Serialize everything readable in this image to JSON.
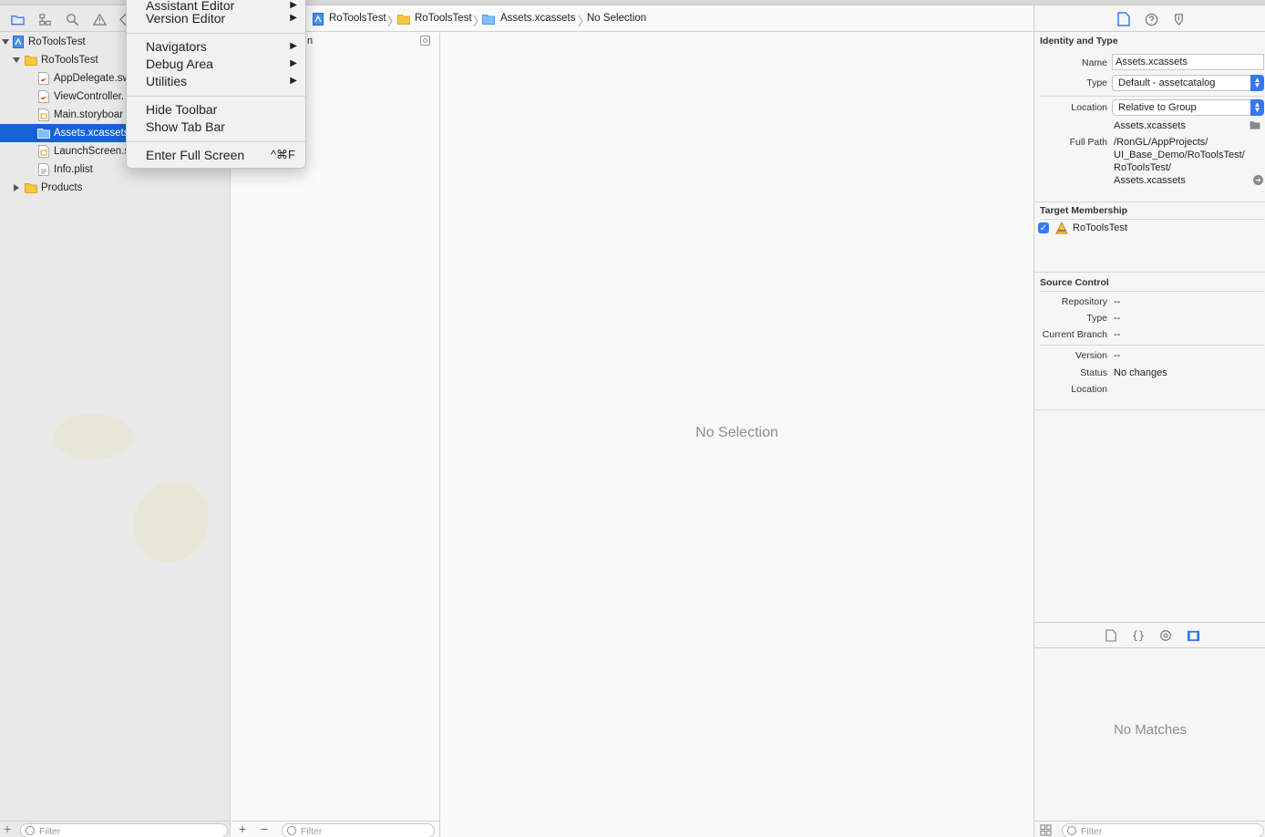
{
  "navigator": {
    "tree": [
      {
        "label": "RoToolsTest",
        "icon": "xcode-project-icon",
        "expanded": true
      },
      {
        "label": "RoToolsTest",
        "icon": "folder-icon",
        "expanded": true
      },
      {
        "label": "AppDelegate.sw",
        "icon": "swift-file-icon"
      },
      {
        "label": "ViewController.",
        "icon": "swift-file-icon"
      },
      {
        "label": "Main.storyboar",
        "icon": "storyboard-file-icon"
      },
      {
        "label": "Assets.xcassets",
        "icon": "asset-catalog-icon",
        "selected": true
      },
      {
        "label": "LaunchScreen.s",
        "icon": "storyboard-file-icon"
      },
      {
        "label": "Info.plist",
        "icon": "plist-file-icon"
      },
      {
        "label": "Products",
        "icon": "folder-icon",
        "expanded": false
      }
    ],
    "filter_placeholder": "Filter"
  },
  "menu": {
    "items": [
      {
        "label": "Assistant Editor",
        "submenu": true
      },
      {
        "label": "Version Editor",
        "submenu": true
      },
      {
        "label": "Navigators",
        "submenu": true
      },
      {
        "label": "Debug Area",
        "submenu": true
      },
      {
        "label": "Utilities",
        "submenu": true
      },
      {
        "label": "Hide Toolbar"
      },
      {
        "label": "Show Tab Bar"
      },
      {
        "label": "Enter Full Screen",
        "shortcut": "^⌘F"
      }
    ]
  },
  "breadcrumb": {
    "items": [
      "RoToolsTest",
      "RoToolsTest",
      "Assets.xcassets",
      "No Selection"
    ]
  },
  "asset_list": {
    "header_fragment": "n",
    "filter_placeholder": "Filter"
  },
  "center": {
    "empty_text": "No Selection"
  },
  "inspector": {
    "identity": {
      "title": "Identity and Type",
      "name_label": "Name",
      "name_value": "Assets.xcassets",
      "type_label": "Type",
      "type_value": "Default - assetcatalog",
      "location_label": "Location",
      "location_value": "Relative to Group",
      "location_file": "Assets.xcassets",
      "full_path_label": "Full Path",
      "full_path_lines": [
        "/RonGL/AppProjects/",
        "UI_Base_Demo/RoToolsTest/",
        "RoToolsTest/",
        "Assets.xcassets"
      ]
    },
    "target": {
      "title": "Target Membership",
      "target_name": "RoToolsTest",
      "checked": true
    },
    "source_control": {
      "title": "Source Control",
      "repository_label": "Repository",
      "repository_value": "--",
      "type_label": "Type",
      "type_value": "--",
      "branch_label": "Current Branch",
      "branch_value": "--",
      "version_label": "Version",
      "version_value": "--",
      "status_label": "Status",
      "status_value": "No changes",
      "location_label": "Location"
    },
    "library": {
      "empty_text": "No Matches",
      "filter_placeholder": "Filter"
    }
  },
  "colors": {
    "selection": "#1663d4",
    "accent": "#3478f6"
  }
}
